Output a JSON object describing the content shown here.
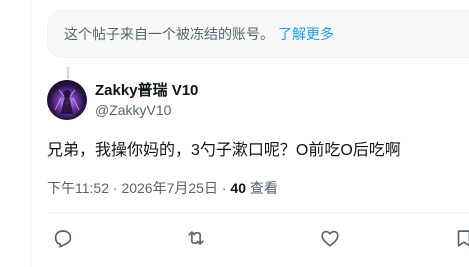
{
  "notice": {
    "text": "这个帖子来自一个被冻结的账号。",
    "link": "了解更多"
  },
  "author": {
    "name": "Zakky普瑞 V10",
    "handle": "@ZakkyV10",
    "avatar_icon": "avatar-image"
  },
  "post": {
    "text": "兄弟，我操你妈的，3勺子漱口呢？O前吃O后吃啊"
  },
  "meta": {
    "time": "下午11:52",
    "separator": "·",
    "date": "2026年7月25日",
    "views_count": "40",
    "views_label": "查看"
  },
  "actions": {
    "icons": [
      "reply-icon",
      "retweet-icon",
      "like-icon",
      "bookmark-icon"
    ]
  },
  "colors": {
    "accent": "#1d9bf0",
    "secondary_text": "#536471",
    "primary_text": "#0f1419",
    "notice_bg": "#f7f9f9",
    "border": "#eff3f4"
  }
}
